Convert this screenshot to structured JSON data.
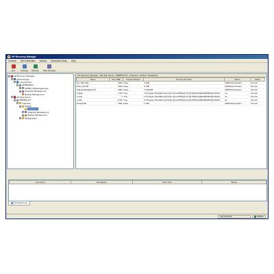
{
  "window": {
    "title": "HP Recovery Manager"
  },
  "menu": [
    "Console",
    "Set Credentials",
    "Actions",
    "Scheduled Tasks",
    "Help"
  ],
  "toolbar": [
    {
      "label": "Exit",
      "icon": "exit-icon",
      "color": "#c0392b"
    },
    {
      "label": "Settings",
      "icon": "settings-icon",
      "color": "#4a78c2"
    },
    {
      "label": "Refresh",
      "icon": "refresh-icon",
      "color": "#2e8b57"
    },
    {
      "label": "Task Manager",
      "icon": "task-manager-icon",
      "color": "#6b6b9a"
    }
  ],
  "tree": [
    {
      "label": "HP Recovery Manager",
      "depth": 0,
      "exp": "-",
      "icon": "app-icon",
      "color": "#b03030"
    },
    {
      "label": "MS Exchange",
      "depth": 1,
      "exp": "-",
      "icon": "exchange-icon",
      "color": "#3a6ea5"
    },
    {
      "label": "Local Domain",
      "depth": 2,
      "exp": "-",
      "icon": "domain-icon",
      "color": "#4a7fb8"
    },
    {
      "label": "MPMMailbox",
      "depth": 3,
      "exp": "-",
      "icon": "server-icon",
      "color": "#6a8fba"
    },
    {
      "label": "MPMM_MSStorageGroup",
      "depth": 4,
      "exp": "+",
      "icon": "storage-group-icon",
      "color": "#7a9c5c"
    },
    {
      "label": "Snapshot Management",
      "depth": 4,
      "exp": "+",
      "icon": "snapshot-icon",
      "color": "#8a6bb0"
    },
    {
      "label": "Backup Management",
      "depth": 4,
      "exp": "",
      "icon": "backup-icon",
      "color": "#c0873b"
    },
    {
      "label": "MS SQL Server",
      "depth": 1,
      "exp": "-",
      "icon": "sql-server-icon",
      "color": "#b03030"
    },
    {
      "label": "MMPBACC3",
      "depth": 2,
      "exp": "-",
      "icon": "server-icon",
      "color": "#6a8fba"
    },
    {
      "label": "Instances",
      "depth": 3,
      "exp": "-",
      "icon": "instances-icon",
      "color": "#d4a92f"
    },
    {
      "label": "Default",
      "depth": 4,
      "exp": "-",
      "icon": "instance-icon",
      "color": "#d4a92f"
    },
    {
      "label": "Databases",
      "depth": 5,
      "exp": "",
      "icon": "databases-icon",
      "color": "#d4a92f",
      "selected": true
    },
    {
      "label": "Snapshot Management",
      "depth": 5,
      "exp": "+",
      "icon": "snapshot-icon",
      "color": "#8a6bb0"
    },
    {
      "label": "Backup Management",
      "depth": 5,
      "exp": "+",
      "icon": "backup-icon",
      "color": "#c0873b"
    },
    {
      "label": "MSSQLINST",
      "depth": 4,
      "exp": "+",
      "icon": "instance-icon",
      "color": "#d4a92f"
    }
  ],
  "breadcrumb": "HP Recovery Manager : MS SQL Server : MMPBACC3 : Instances : Default : Databases",
  "db_table": {
    "columns": [
      "Name",
      "Size (MB)",
      "IsSystemObject",
      "Primary File Path",
      "Owner",
      "Status"
    ],
    "rows": [
      [
        "PC_DB_ACE",
        "4000",
        "False",
        "S:\\DB",
        "MPM\\Administrator",
        "Normal"
      ],
      [
        "PDA_Set DB",
        "3000",
        "False",
        "S:\\DB",
        "MPM\\Administrator",
        "Normal"
      ],
      [
        "SQLHostDatabaseTC",
        "4000",
        "False",
        "J:\\SQLDB",
        "MPM\\Administrator",
        "Normal"
      ],
      [
        "master",
        "5.25",
        "True",
        "C:\\Program Files\\Microsoft SQL Server\\MSSQL10_50.MSSQLSERVER\\MSSQL\\DATA",
        "sa",
        "Normal"
      ],
      [
        "model",
        "3",
        "True",
        "C:\\Program Files\\Microsoft SQL Server\\MSSQL10_50.MSSQLSERVER\\MSSQL\\DATA",
        "sa",
        "Normal"
      ],
      [
        "msdb",
        "17.81",
        "True",
        "C:\\Program Files\\Microsoft SQL Server\\MSSQL10_50.MSSQLSERVER\\MSSQL\\DATA",
        "sa",
        "Normal"
      ],
      [
        "ReSpartdb",
        "2000",
        "False",
        "L:\\DB",
        "MPM\\Administrator",
        "Normal"
      ]
    ]
  },
  "command_table": {
    "columns": [
      "Command",
      "Description",
      "Start Time",
      "Status"
    ]
  },
  "command_tab": "Command Log",
  "status": {
    "user": "administrator",
    "server": "MMdev"
  }
}
